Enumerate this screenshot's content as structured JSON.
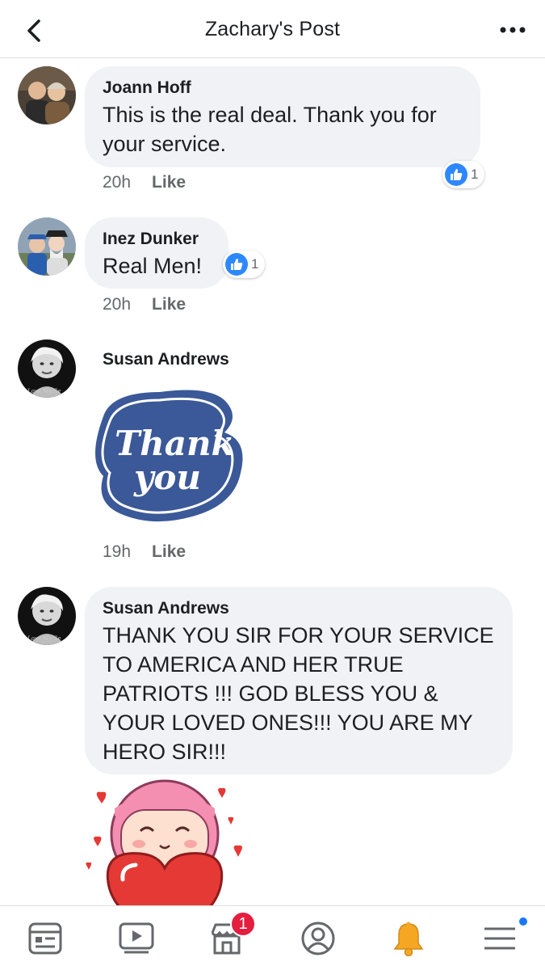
{
  "header": {
    "title": "Zachary's Post",
    "back_icon": "chevron-left-icon",
    "more_icon": "more-horizontal-icon"
  },
  "comments": [
    {
      "author": "Joann Hoff",
      "text": "This is the real deal. Thank you for your service.",
      "time": "20h",
      "like_label": "Like",
      "reaction_count": "1"
    },
    {
      "author": "Inez Dunker",
      "text": "Real Men!",
      "time": "20h",
      "like_label": "Like",
      "reaction_count": "1"
    },
    {
      "author": "Susan Andrews",
      "sticker": "Thank you",
      "time": "19h",
      "like_label": "Like"
    },
    {
      "author": "Susan Andrews",
      "text": "THANK YOU SIR FOR YOUR SERVICE TO AMERICA AND HER TRUE PATRIOTS !!! GOD BLESS YOU & YOUR LOVED ONES!!! YOU ARE MY HERO SIR!!!"
    }
  ],
  "bottom_nav": {
    "items": [
      "news-feed-icon",
      "watch-icon",
      "marketplace-icon",
      "profile-icon",
      "notifications-icon",
      "menu-icon"
    ],
    "marketplace_badge": "1"
  },
  "colors": {
    "accent": "#1877f2",
    "bubble": "#f0f2f5",
    "secondary_text": "#65676b",
    "sticker_blue": "#3b5998",
    "badge_red": "#e41e3f",
    "bell": "#f5a623"
  }
}
